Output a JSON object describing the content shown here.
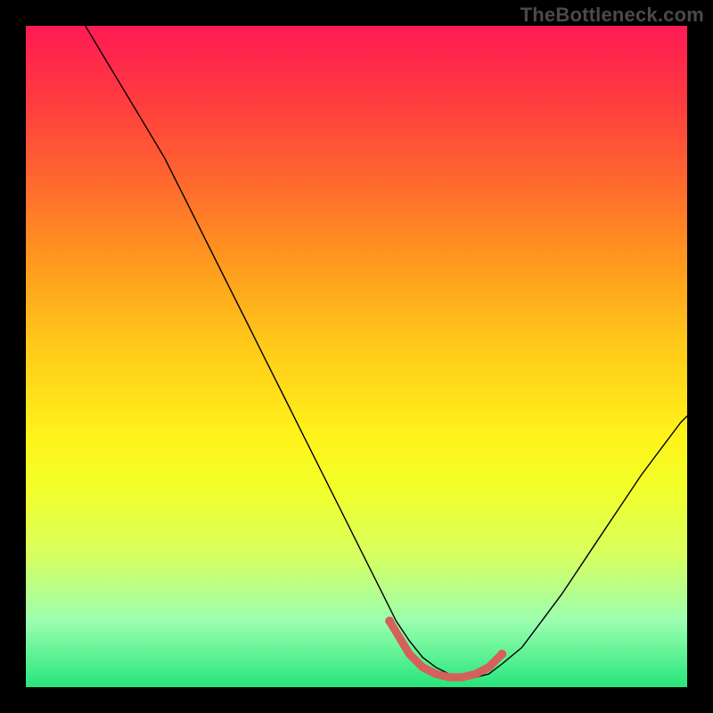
{
  "watermark": "TheBottleneck.com",
  "chart_data": {
    "type": "line",
    "title": "",
    "xlabel": "",
    "ylabel": "",
    "xlim": [
      0,
      100
    ],
    "ylim": [
      0,
      100
    ],
    "grid": false,
    "legend": false,
    "series": [
      {
        "name": "curve",
        "x": [
          9,
          12,
          15,
          18,
          21,
          24,
          27,
          30,
          33,
          36,
          39,
          42,
          45,
          48,
          51,
          54,
          56,
          58,
          60,
          62,
          64,
          66,
          68,
          70,
          72,
          75,
          78,
          81,
          84,
          87,
          90,
          93,
          96,
          99,
          100
        ],
        "y": [
          100,
          95,
          90,
          85,
          80,
          74,
          68,
          62,
          56,
          50,
          44,
          38,
          32,
          26,
          20,
          14,
          10,
          7,
          4.5,
          3,
          2,
          1.5,
          1.5,
          2,
          3.5,
          6,
          10,
          14,
          18.5,
          23,
          27.5,
          32,
          36,
          40,
          41
        ]
      }
    ],
    "highlight": {
      "name": "bottom-marker",
      "color": "#d6605a",
      "x": [
        55,
        58,
        60,
        62,
        64,
        66,
        68,
        70,
        72
      ],
      "y": [
        10,
        5,
        3,
        2,
        1.5,
        1.5,
        2,
        3,
        5
      ]
    },
    "background_gradient": {
      "top": "#ff1a54",
      "mid": "#fff31a",
      "bottom": "#26e57c"
    }
  }
}
